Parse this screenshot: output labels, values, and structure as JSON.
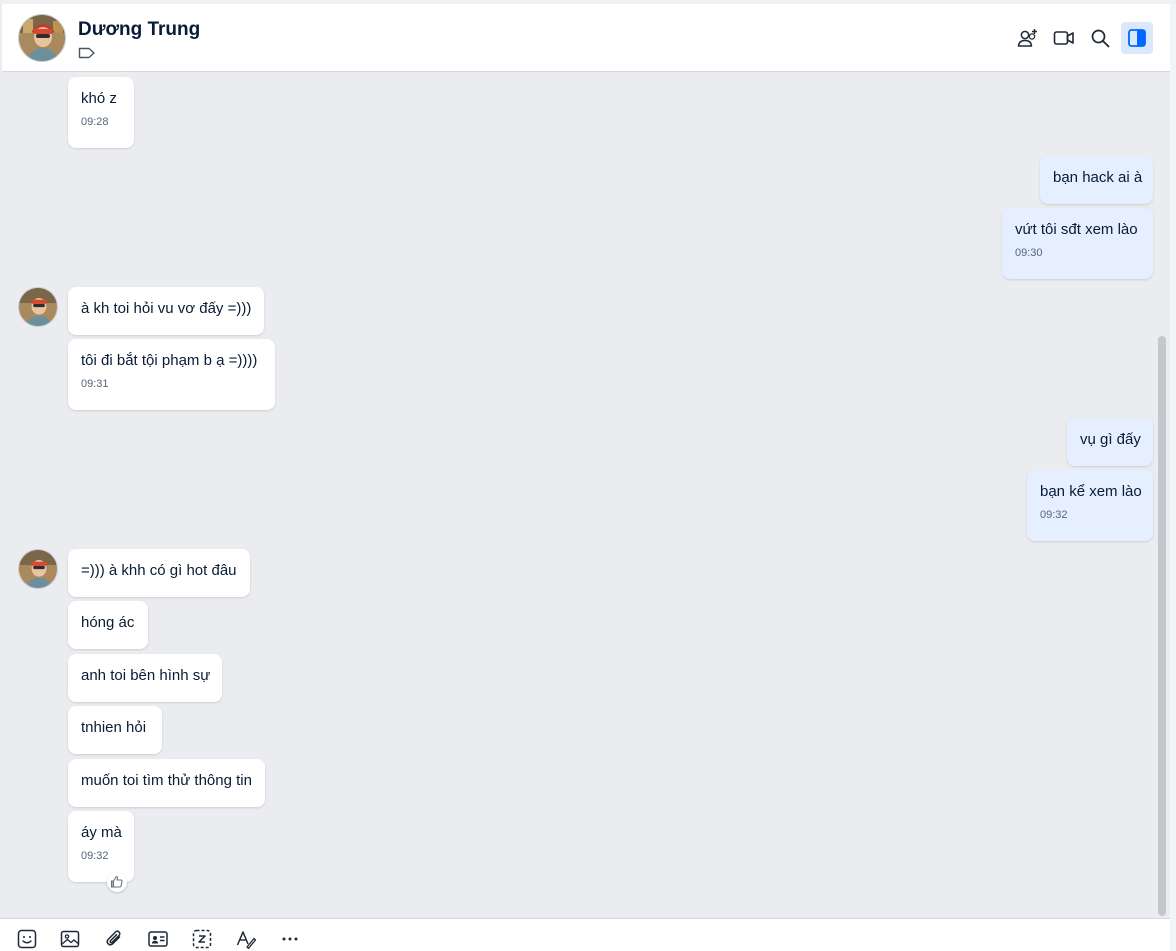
{
  "header": {
    "contact_name": "Dương Trung"
  },
  "icons": {
    "tag": "tag-icon",
    "add_member": "add-member-icon",
    "video_call": "video-call-icon",
    "search": "search-icon",
    "toggle_panel": "toggle-panel-icon",
    "like": "thumbs-up-icon"
  },
  "colors": {
    "accent": "#0068ff",
    "bubble_me": "#e5efff",
    "bubble_them": "#ffffff",
    "background": "#eaecf0"
  },
  "messages": [
    {
      "sender": "them",
      "text": "khó z",
      "time": "09:28"
    },
    {
      "sender": "me",
      "text": "bạn hack ai à",
      "time": ""
    },
    {
      "sender": "me",
      "text": "vứt tôi sđt xem lào",
      "time": "09:30"
    },
    {
      "sender": "them",
      "text": "à kh toi hỏi vu vơ đấy =)))",
      "time": ""
    },
    {
      "sender": "them",
      "text": "tôi đi bắt tội phạm b ạ =))))",
      "time": "09:31"
    },
    {
      "sender": "me",
      "text": "vụ gì đấy",
      "time": ""
    },
    {
      "sender": "me",
      "text": "bạn kể xem lào",
      "time": "09:32"
    },
    {
      "sender": "them",
      "text": "=))) à khh có gì hot đâu",
      "time": ""
    },
    {
      "sender": "them",
      "text": "hóng ác",
      "time": ""
    },
    {
      "sender": "them",
      "text": "anh toi bên hình sự",
      "time": ""
    },
    {
      "sender": "them",
      "text": "tnhien hỏi",
      "time": ""
    },
    {
      "sender": "them",
      "text": "muốn toi tìm thử thông tin",
      "time": ""
    },
    {
      "sender": "them",
      "text": "áy mà",
      "time": "09:32"
    }
  ],
  "toolbar": [
    {
      "name": "sticker-icon"
    },
    {
      "name": "image-icon"
    },
    {
      "name": "attach-icon"
    },
    {
      "name": "contact-card-icon"
    },
    {
      "name": "screenshot-icon"
    },
    {
      "name": "format-text-icon"
    },
    {
      "name": "more-icon"
    }
  ]
}
